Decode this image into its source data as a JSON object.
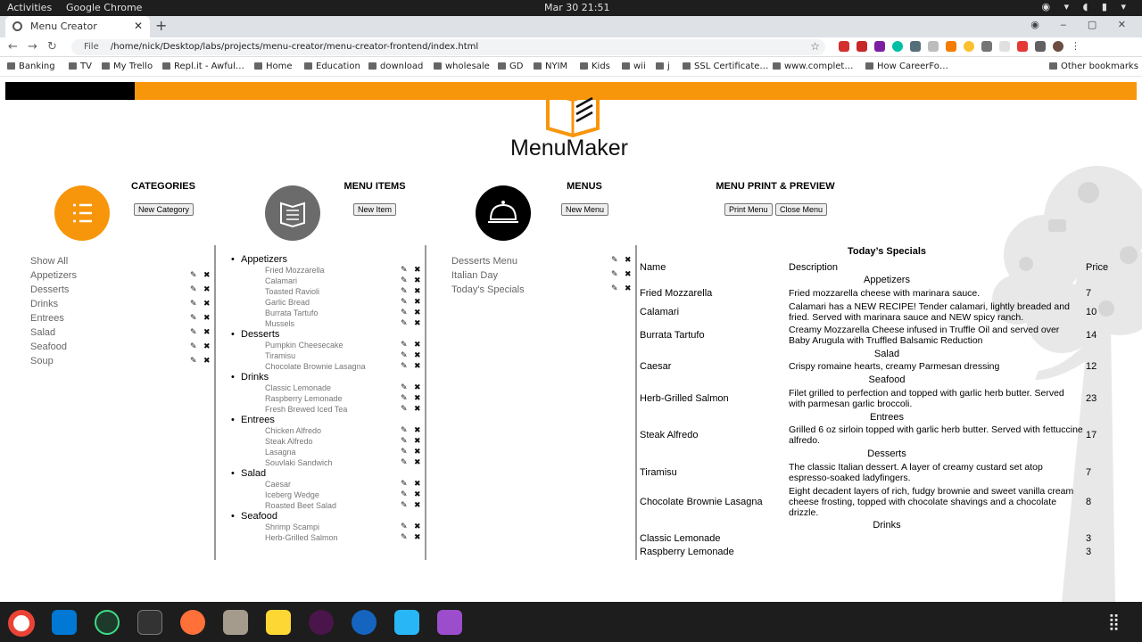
{
  "system": {
    "activities": "Activities",
    "app": "Google Chrome",
    "clock": "Mar 30  21:51"
  },
  "browser": {
    "tab_title": "Menu Creator",
    "url_prefix": "File",
    "url": "/home/nick/Desktop/labs/projects/menu-creator/menu-creator-frontend/index.html",
    "bookmarks": [
      "Banking",
      "TV",
      "My Trello",
      "Repl.it - Awful…",
      "Home",
      "Education",
      "download",
      "wholesale",
      "GD",
      "NYIM",
      "Kids",
      "wii",
      "j",
      "SSL Certificate…",
      "www.complet…",
      "How CareerFo…",
      "Other bookmarks"
    ]
  },
  "brand": {
    "logo_text": "MenuMaker",
    "orange": "#f8960b"
  },
  "sections": {
    "categories": {
      "title": "CATEGORIES",
      "button": "New Category"
    },
    "items": {
      "title": "MENU ITEMS",
      "button": "New Item"
    },
    "menus": {
      "title": "MENUS",
      "button": "New Menu"
    },
    "preview": {
      "title": "MENU PRINT & PREVIEW",
      "print_button": "Print Menu",
      "close_button": "Close Menu"
    }
  },
  "categories": [
    "Show All",
    "Appetizers",
    "Desserts",
    "Drinks",
    "Entrees",
    "Salad",
    "Seafood",
    "Soup"
  ],
  "menu_items": [
    {
      "group": "Appetizers",
      "items": [
        "Fried Mozzarella",
        "Calamari",
        "Toasted Ravioli",
        "Garlic Bread",
        "Burrata Tartufo",
        "Mussels"
      ]
    },
    {
      "group": "Desserts",
      "items": [
        "Pumpkin Cheesecake",
        "Tiramisu",
        "Chocolate Brownie Lasagna"
      ]
    },
    {
      "group": "Drinks",
      "items": [
        "Classic Lemonade",
        "Raspberry Lemonade",
        "Fresh Brewed Iced Tea"
      ]
    },
    {
      "group": "Entrees",
      "items": [
        "Chicken Alfredo",
        "Steak Alfredo",
        "Lasagna",
        "Souvlaki Sandwich"
      ]
    },
    {
      "group": "Salad",
      "items": [
        "Caesar",
        "Iceberg Wedge",
        "Roasted Beet Salad"
      ]
    },
    {
      "group": "Seafood",
      "items": [
        "Shrimp Scampi",
        "Herb-Grilled Salmon"
      ]
    }
  ],
  "menus": [
    "Desserts Menu",
    "Italian Day",
    "Today's Specials"
  ],
  "preview": {
    "title": "Today’s Specials",
    "col_name": "Name",
    "col_desc": "Description",
    "col_price": "Price",
    "rows": [
      {
        "type": "section",
        "text": "Appetizers"
      },
      {
        "type": "item",
        "name": "Fried Mozzarella",
        "desc": "Fried mozzarella cheese with marinara sauce.",
        "price": "7"
      },
      {
        "type": "item",
        "name": "Calamari",
        "desc": "Calamari has a NEW RECIPE! Tender calamari, lightly breaded and fried. Served with marinara sauce and NEW spicy ranch.",
        "price": "10"
      },
      {
        "type": "item",
        "name": "Burrata Tartufo",
        "desc": "Creamy Mozzarella Cheese infused in Truffle Oil and served over Baby Arugula with Truffled Balsamic Reduction",
        "price": "14"
      },
      {
        "type": "section",
        "text": "Salad"
      },
      {
        "type": "item",
        "name": "Caesar",
        "desc": "Crispy romaine hearts, creamy Parmesan dressing",
        "price": "12"
      },
      {
        "type": "section",
        "text": "Seafood"
      },
      {
        "type": "item",
        "name": "Herb-Grilled Salmon",
        "desc": "Filet grilled to perfection and topped with garlic herb butter. Served with parmesan garlic broccoli.",
        "price": "23"
      },
      {
        "type": "section",
        "text": "Entrees"
      },
      {
        "type": "item",
        "name": "Steak Alfredo",
        "desc": "Grilled 6 oz sirloin topped with garlic herb butter. Served with fettuccine alfredo.",
        "price": "17"
      },
      {
        "type": "section",
        "text": "Desserts"
      },
      {
        "type": "item",
        "name": "Tiramisu",
        "desc": "The classic Italian dessert. A layer of creamy custard set atop espresso-soaked ladyfingers.",
        "price": "7"
      },
      {
        "type": "item",
        "name": "Chocolate Brownie Lasagna",
        "desc": "Eight decadent layers of rich, fudgy brownie and sweet vanilla cream cheese frosting, topped with chocolate shavings and a chocolate drizzle.",
        "price": "8"
      },
      {
        "type": "section",
        "text": "Drinks"
      },
      {
        "type": "item",
        "name": "Classic Lemonade",
        "desc": "",
        "price": "3"
      },
      {
        "type": "item",
        "name": "Raspberry Lemonade",
        "desc": "",
        "price": "3"
      }
    ]
  },
  "icons": {
    "edit": "✎",
    "delete": "✖"
  }
}
